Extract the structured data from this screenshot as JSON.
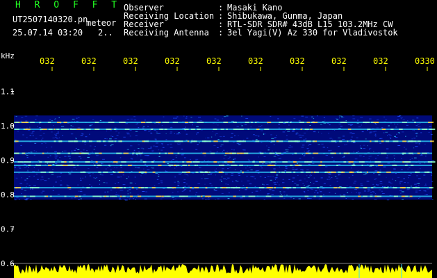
{
  "header": {
    "app_name": "H R O F F T",
    "filename": "UT2507140320.pn",
    "meteor_label": "meteor",
    "datetime": "25.07.14 03:20",
    "page_indicator": "2..",
    "fields": [
      {
        "label": "Observer",
        "sep": ":",
        "value": "Masaki Kano"
      },
      {
        "label": "Receiving Location",
        "sep": ":",
        "value": "Shibukawa, Gunma, Japan"
      },
      {
        "label": "Receiver",
        "sep": ":",
        "value": "RTL-SDR SDR# 43dB L15 103.2MHz CW"
      },
      {
        "label": "Receiving Antenna",
        "sep": ":",
        "value": "3el Yagi(V) Az 330 for Vladivostok"
      }
    ]
  },
  "spectrogram": {
    "y_unit": "kHz",
    "y_ticks": [
      "1.1",
      "1.0",
      "0.9",
      "0.8",
      "0.7",
      "0.6"
    ],
    "y_tick_values": [
      1.1,
      1.0,
      0.9,
      0.8,
      0.7,
      0.6
    ],
    "x_ticks": [
      "032",
      "032",
      "032",
      "032",
      "032",
      "032",
      "032",
      "032",
      "032",
      "0330"
    ],
    "band_range_khz": [
      0.785,
      1.03
    ],
    "strong_lines_khz": [
      1.01,
      0.99,
      0.955,
      0.92,
      0.895,
      0.885,
      0.865,
      0.82,
      0.795
    ],
    "colors": {
      "background": "#000000",
      "noise_dim": "#000a7a",
      "noise_mid": "#1f4fff",
      "line_cyan": "#33d8ff",
      "line_hot": "#ffd040",
      "axis_text": "#ffffff",
      "tick_text": "#ffff00",
      "power_trace": "#ffff00"
    }
  }
}
